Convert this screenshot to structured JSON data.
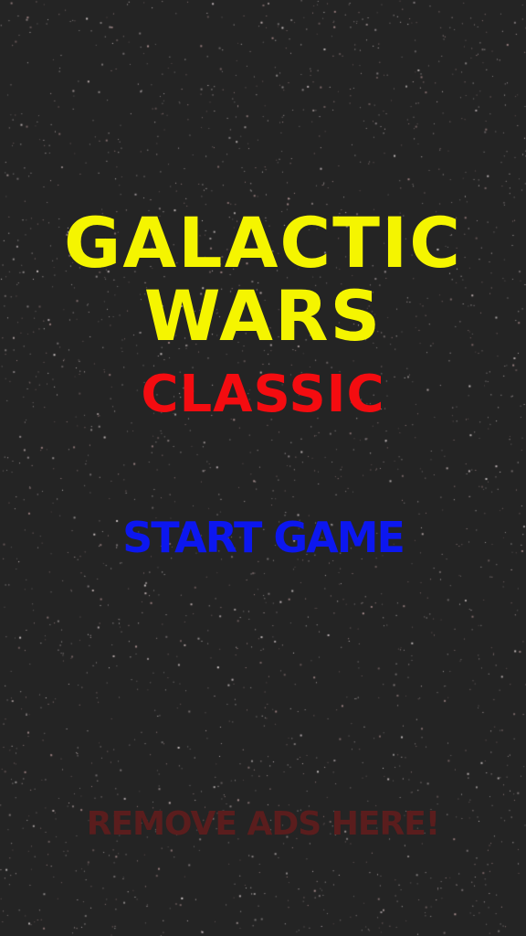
{
  "title": {
    "line1": "GALACTIC",
    "line2": "WARS",
    "subtitle": "CLASSIC"
  },
  "menu": {
    "start_label": "START GAME",
    "remove_ads_label": "REMOVE ADS HERE!"
  },
  "colors": {
    "background": "#242424",
    "title": "#f5f500",
    "subtitle": "#f40c10",
    "start_button": "#0c17ef",
    "remove_ads": "#5a1d1d",
    "stars": "#cfc3c3"
  }
}
